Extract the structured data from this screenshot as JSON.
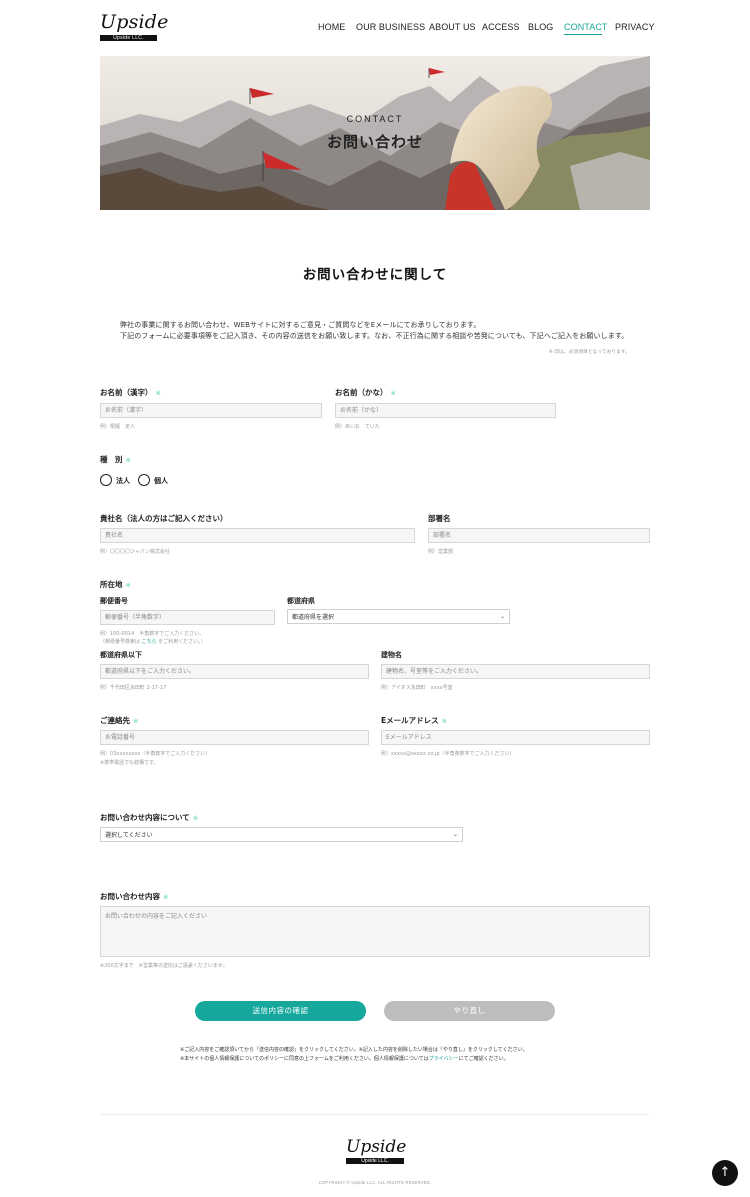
{
  "header": {
    "logo": "Upside",
    "logo_sub": "Upside LLC.",
    "nav": [
      {
        "label": "HOME"
      },
      {
        "label": "OUR BUSINESS"
      },
      {
        "label": "ABOUT US"
      },
      {
        "label": "ACCESS"
      },
      {
        "label": "BLOG"
      },
      {
        "label": "CONTACT",
        "active": true
      },
      {
        "label": "PRIVACY"
      }
    ]
  },
  "hero": {
    "subtitle": "CONTACT",
    "title": "お問い合わせ"
  },
  "intro": {
    "title": "お問い合わせに関して",
    "line1": "弊社の事業に関するお問い合わせ、WEBサイトに対するご意見・ご質問などをEメールにてお承りしております。",
    "line2": "下記のフォームに必要事項等をご記入頂き、その内容の送信をお願い致します。なお、不正行為に関する相談や苦発についても、下記へご記入をお願いします。",
    "required_note": "※ 印は、必須項目となっております。"
  },
  "form": {
    "required_mark": "※",
    "name_kanji": {
      "label": "お名前（漢字）",
      "placeholder": "お名前（漢字）",
      "hint": "例）桐堰　定人"
    },
    "name_kana": {
      "label": "お名前（かな）",
      "placeholder": "お名前（かな）",
      "hint": "例）あいお　ていた"
    },
    "type": {
      "label": "種　別",
      "options": [
        "法人",
        "個人"
      ]
    },
    "company": {
      "label": "貴社名（法人の方はご記入ください）",
      "placeholder": "貴社名",
      "hint": "例）〇〇〇〇ジャパン株式会社"
    },
    "department": {
      "label": "部署名",
      "placeholder": "部署名",
      "hint": "例）営業部"
    },
    "address": {
      "label": "所在地",
      "zip": {
        "label": "郵便番号",
        "placeholder": "郵便番号（半角数字）",
        "hint1": "例）100-0014　半角数字でご入力ください。",
        "hint2_pre": "（郵便番号検索は ",
        "hint2_link": "こちら",
        "hint2_post": " をご利用ください。）"
      },
      "prefecture": {
        "label": "都道府県",
        "selected": "都道府県を選択"
      },
      "city": {
        "label": "都道府県以下",
        "placeholder": "都道府県以下をご入力ください。",
        "hint": "例）千代田区永田町 2-17-17"
      },
      "building": {
        "label": "建物名",
        "placeholder": "建物名、号室等をご入力ください。",
        "hint": "例）アイオス永田町　xxxx号室"
      }
    },
    "phone": {
      "label": "ご連絡先",
      "placeholder": "お電話番号",
      "hint1": "例）03xxxxxxxx（半角数字でご入力ください）",
      "hint2": "※携帯電話でも結構です。"
    },
    "email": {
      "label": "Eメールアドレス",
      "placeholder": "Eメールアドレス",
      "hint": "例）xxxxx@xxxxx.co.jp（半角英数字でご入力ください）"
    },
    "inquiry_type": {
      "label": "お問い合わせ内容について",
      "selected": "選択してください"
    },
    "inquiry": {
      "label": "お問い合わせ内容",
      "placeholder": "お問い合わせの内容をご記入ください",
      "hint": "※200文字まで　※営業等の送信はご遠慮くださいませ。"
    },
    "confirm_button": "送信内容の確認",
    "reset_button": "やり直し",
    "note1": "※ご記入内容をご確認頂いてから『送信内容の確認』をクリックしてください。※記入した内容を削除したい場合は『やり直し』をクリックしてください。",
    "note2_pre": "※本サイトの個人情報保護についてのポリシーに同意の上フォームをご利用ください。個人情報保護については",
    "note2_link": "プライバシー",
    "note2_post": "にてご確認ください。"
  },
  "footer": {
    "logo": "Upside",
    "logo_sub": "Upside LLC.",
    "copyright": "COPYRIGHT © Upside LLC. ALL RIGHTS RESERVED.",
    "to_top_icon": "arrow-up-icon"
  },
  "colors": {
    "accent": "#16a89c",
    "required": "#57d0b6",
    "reset": "#bdbdbd"
  }
}
